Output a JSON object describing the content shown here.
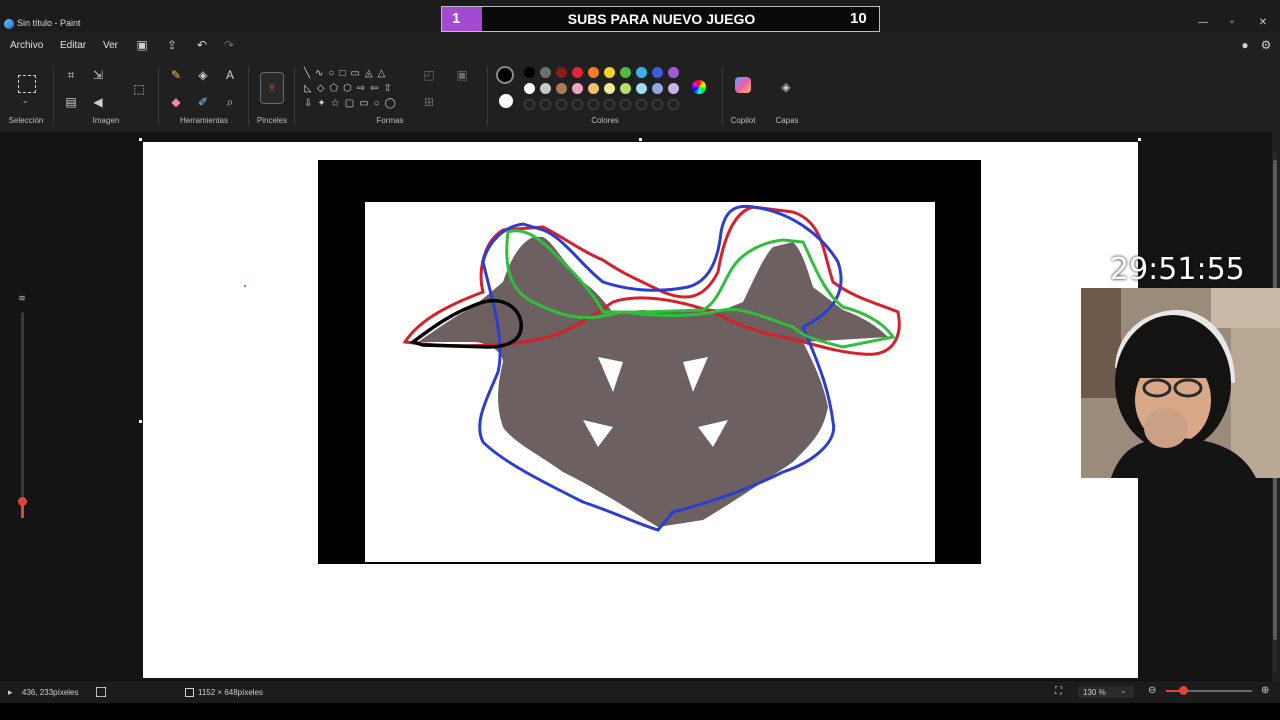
{
  "window": {
    "title": "Sin título - Paint",
    "minimize": "—",
    "maximize": "▫",
    "close": "✕"
  },
  "overlay": {
    "subs_count": "1",
    "subs_text": "SUBS PARA NUEVO JUEGO",
    "subs_goal": "10",
    "timer": "29:51:55"
  },
  "menu": {
    "items": [
      "Archivo",
      "Editar",
      "Ver"
    ]
  },
  "ribbon": {
    "groups": [
      "Selección",
      "Imagen",
      "Herramientas",
      "Pinceles",
      "Formas",
      "Colores",
      "Copilot",
      "Capas"
    ]
  },
  "colors": {
    "primary": "#000000",
    "secondary": "#ffffff",
    "palette_row1": [
      "#000000",
      "#6e6e6e",
      "#8b1a1a",
      "#e0243c",
      "#ef7b2b",
      "#f7d02a",
      "#52b94a",
      "#3bb0e6",
      "#3a5fd9",
      "#a05ad6"
    ],
    "palette_row2": [
      "#ffffff",
      "#c8c8c8",
      "#b07a56",
      "#f3a3c0",
      "#f5c06e",
      "#f2e79a",
      "#b5e06a",
      "#9fdcef",
      "#90a9e6",
      "#c7b2e6"
    ]
  },
  "status": {
    "cursor_pos": "436, 233píxeles",
    "canvas_size": "1152 × 648píxeles",
    "zoom": "130 %"
  }
}
